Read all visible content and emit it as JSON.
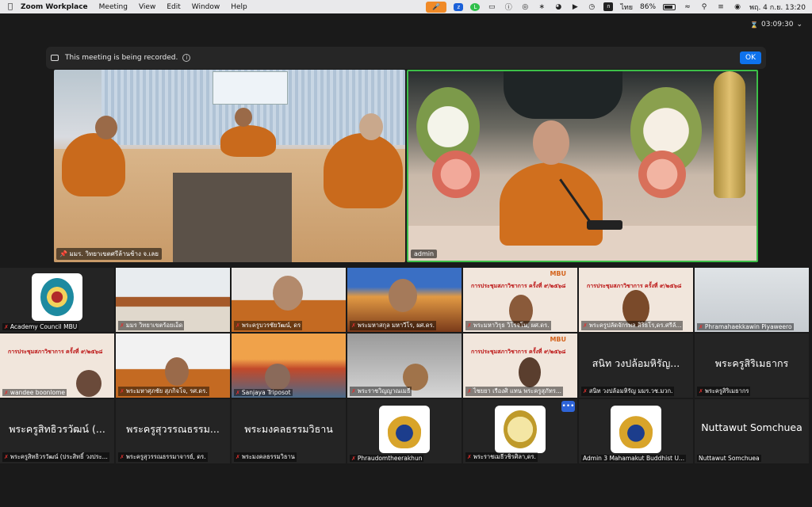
{
  "menubar": {
    "app_name": "Zoom Workplace",
    "menus": [
      "Meeting",
      "View",
      "Edit",
      "Window",
      "Help"
    ],
    "language": "ไทย",
    "battery": "86%",
    "battery_level": 0.86,
    "datetime": "พฤ. 4 ก.ย.  13:20"
  },
  "meeting": {
    "timer": "03:09:30",
    "recording_banner": {
      "message": "This meeting is being recorded.",
      "ok_label": "OK"
    }
  },
  "speakers": [
    {
      "name": "มมร. วิทยาเขตศรีล้านช้าง จ.เลย"
    },
    {
      "name": "admin"
    }
  ],
  "gallery": {
    "row1": [
      {
        "label": "Academy Council MBU"
      },
      {
        "label": "มมร วิทยาเขตร้อยเอ็ด"
      },
      {
        "label": "พระครูบวรชัยวัฒน์, ดร"
      },
      {
        "label": "พระมหาสกุล มหาวีโร, ผศ.ดร."
      },
      {
        "label": "พระมหาวิรุธ วิโรจโน, ผศ.ดร."
      },
      {
        "label": "พระครูปลัดจักรพล สิริธโร,ดร.ศรีล้..."
      },
      {
        "label": "Phramahaekkawin Piyaweero"
      }
    ],
    "row2": [
      {
        "label": "wandee boonlome"
      },
      {
        "label": "พระมหาศุภชัย สุภกิจโจ, รศ.ดร."
      },
      {
        "label": "Sanjaya Triposot"
      },
      {
        "label": "พระราชวิญญาณเมธี"
      },
      {
        "label": "ไชยยา เรืองศิ  แทน  พระครูสุภัทร..."
      },
      {
        "big_name": "สนิท  วงปล้อมหิรัญ...",
        "label": "สนิท  วงปล้อมหิรัญ มมร.วช.มวก."
      },
      {
        "big_name": "พระครูสิริเมธากร",
        "label": "พระครูสิริเมธากร"
      }
    ],
    "row3": [
      {
        "big_name": "พระครูสิทธิวรวัฒน์ (...",
        "label": "พระครูสิทธิวรวัฒน์ (ประสิทธิ์ วงประ..."
      },
      {
        "big_name": "พระครูสุวรรณธรรม...",
        "label": "พระครูสุวรรณธรรมาจารย์, ดร."
      },
      {
        "big_name": "พระมงคลธรรมวิธาน",
        "label": "พระมงคลธรรมวิธาน"
      },
      {
        "label": "Phraudomtheerakhun"
      },
      {
        "label": "พระราชเมธีวชิรศิลา,ดร."
      },
      {
        "label": "Admin 3 Mahamakut Buddhist U..."
      },
      {
        "big_name": "Nuttawut Somchuea",
        "label": "Nuttawut Somchuea"
      }
    ],
    "slide": {
      "brand": "MBU",
      "title": "การประชุมสภาวิชาการ ครั้งที่ ๙/๒๕๖๘"
    },
    "more_label": "•••"
  },
  "colors": {
    "active_speaker_border": "#3cbf48",
    "ok_button": "#0e72ed",
    "muted_icon": "#e0312f",
    "mic_indicator": "#f08a27"
  }
}
